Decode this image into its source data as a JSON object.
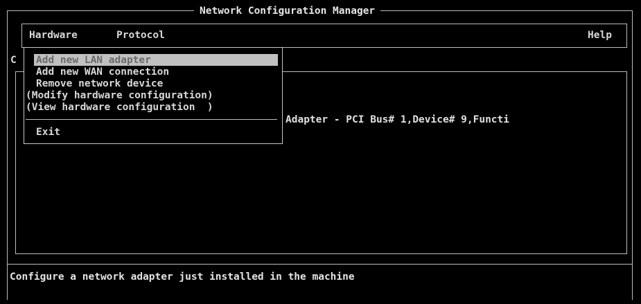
{
  "window": {
    "title": "Network Configuration Manager"
  },
  "menubar": {
    "items": [
      {
        "label": "Hardware"
      },
      {
        "label": "Protocol"
      },
      {
        "label": "Help"
      }
    ]
  },
  "dropdown": {
    "items": [
      {
        "label": "Add new LAN adapter",
        "selected": true
      },
      {
        "label": "Add new WAN connection"
      },
      {
        "label": "Remove network device"
      },
      {
        "label": "(Modify hardware configuration)"
      },
      {
        "label": "(View hardware configuration  )"
      }
    ],
    "exit_label": "Exit"
  },
  "content": {
    "partial_label": "C",
    "row_text": "Adapter - PCI Bus# 1,Device# 9,Functi"
  },
  "status": {
    "text": "Configure a network adapter just installed in the machine"
  },
  "colors": {
    "background": "#000000",
    "foreground": "#d8d8d8",
    "highlight_bg": "#c0c0c0",
    "highlight_fg": "#6a6a6a"
  }
}
